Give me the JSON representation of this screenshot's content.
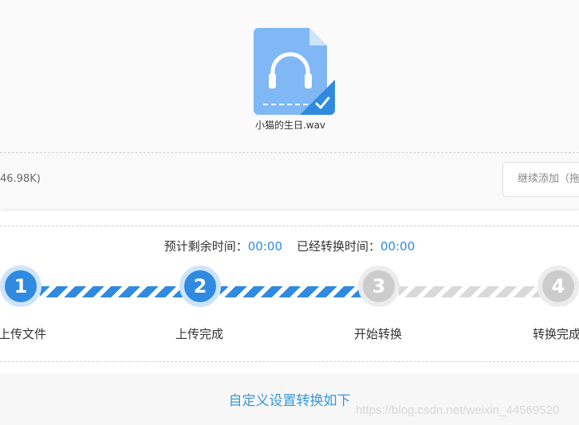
{
  "upload": {
    "file_name": "小猫的生日.wav",
    "size_text": "46.98K)",
    "continue_button": "继续添加（拖"
  },
  "progress": {
    "remaining_label": "预计剩余时间：",
    "remaining_value": "00:00",
    "elapsed_label": "已经转换时间：",
    "elapsed_value": "00:00",
    "steps": [
      {
        "number": "1",
        "label": "上传文件",
        "state": "done"
      },
      {
        "number": "2",
        "label": "上传完成",
        "state": "done"
      },
      {
        "number": "3",
        "label": "开始转换",
        "state": "todo"
      },
      {
        "number": "4",
        "label": "转换完成",
        "state": "todo"
      }
    ]
  },
  "bottom": {
    "custom_settings_link": "自定义设置转换如下"
  },
  "watermark": "https://blog.csdn.net/weixin_44569520",
  "colors": {
    "accent": "#2f8ae0",
    "file_icon": "#7fb8f5",
    "inactive": "#cccccc",
    "link": "#3a98d8"
  },
  "icons": {
    "file": "audio-file-headphones-icon",
    "check": "check-icon"
  }
}
